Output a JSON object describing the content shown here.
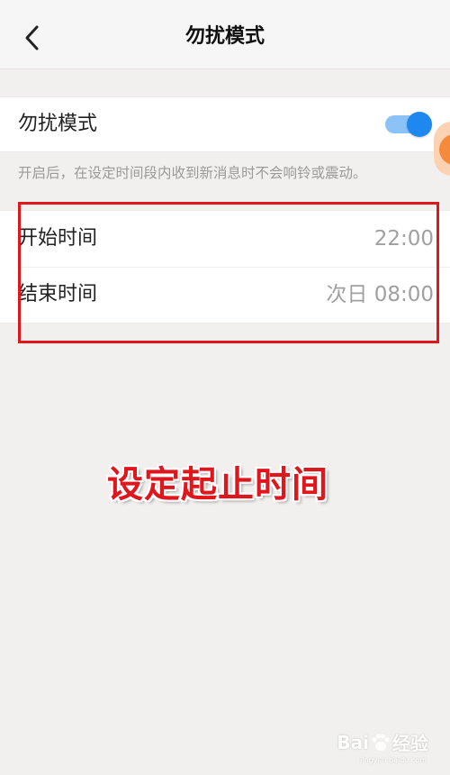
{
  "nav": {
    "title": "勿扰模式",
    "back_icon": "chevron-left-icon"
  },
  "dnd": {
    "label": "勿扰模式",
    "enabled": true,
    "hint": "开启后，在设定时间段内收到新消息时不会响铃或震动。"
  },
  "schedule": {
    "start": {
      "label": "开始时间",
      "value": "22:00"
    },
    "end": {
      "label": "结束时间",
      "value": "次日 08:00"
    }
  },
  "annotation": {
    "text": "设定起止时间"
  },
  "watermark": {
    "brand_left": "Bai",
    "brand_right": "经验",
    "url": "jingyan.baidu.com"
  },
  "colors": {
    "toggle_on": "#1e88f0",
    "annotation": "#e0161d",
    "float_ball": "#f58a3c"
  }
}
